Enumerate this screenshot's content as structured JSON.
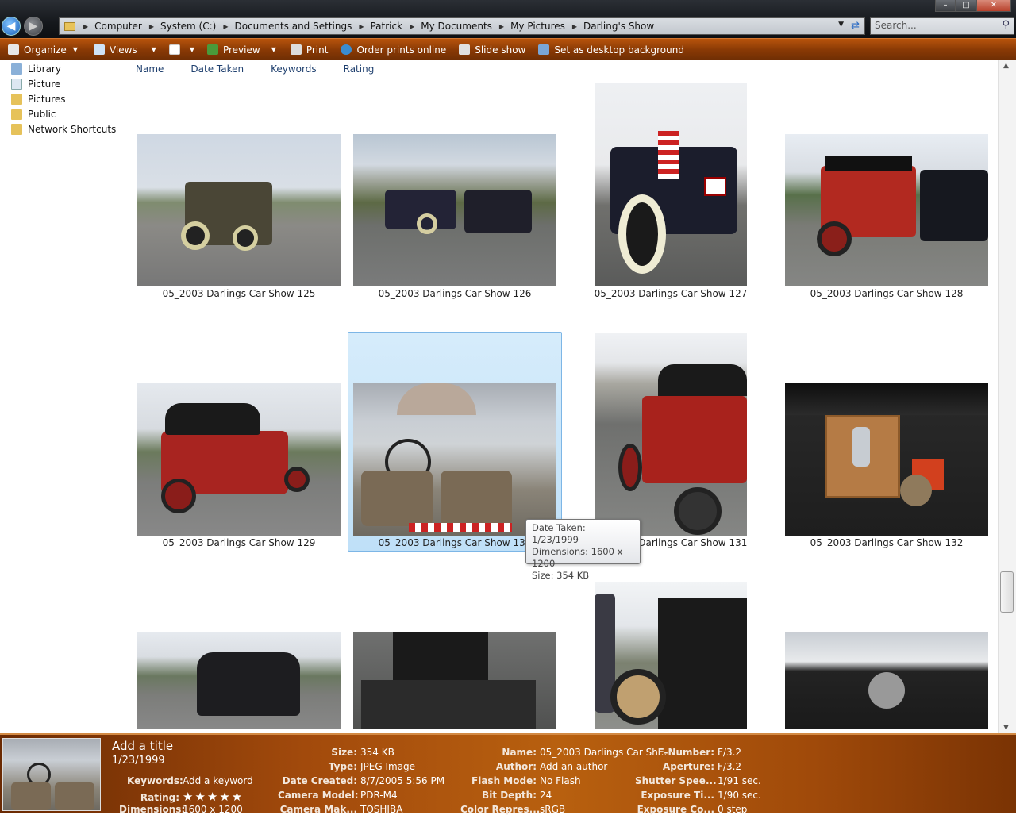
{
  "window": {
    "controls": [
      "–",
      "□",
      "✕"
    ]
  },
  "address": {
    "crumbs": [
      "Computer",
      "System (C:)",
      "Documents and Settings",
      "Patrick",
      "My Documents",
      "My Pictures",
      "Darling's Show"
    ]
  },
  "search": {
    "placeholder": "Search..."
  },
  "toolbar": {
    "organize": "Organize",
    "views": "Views",
    "preview": "Preview",
    "print": "Print",
    "order": "Order prints online",
    "slideshow": "Slide show",
    "desktop": "Set as desktop background"
  },
  "sidebar": {
    "items": [
      {
        "label": "Library",
        "icon": "library-icon"
      },
      {
        "label": "Picture",
        "icon": "picture-icon"
      },
      {
        "label": "Pictures",
        "icon": "folder-icon"
      },
      {
        "label": "Public",
        "icon": "folder-icon"
      },
      {
        "label": "Network Shortcuts",
        "icon": "folder-icon"
      }
    ]
  },
  "columns": [
    "Name",
    "Date Taken",
    "Keywords",
    "Rating"
  ],
  "photos": [
    {
      "caption": "05_2003 Darlings Car Show 125"
    },
    {
      "caption": "05_2003 Darlings Car Show 126"
    },
    {
      "caption": "05_2003 Darlings Car Show 127"
    },
    {
      "caption": "05_2003 Darlings Car Show 128"
    },
    {
      "caption": "05_2003 Darlings Car Show 129"
    },
    {
      "caption": "05_2003 Darlings Car Show 130"
    },
    {
      "caption": "05_2003 Darlings Car Show 131"
    },
    {
      "caption": "05_2003 Darlings Car Show 132"
    }
  ],
  "tooltip": {
    "date": "Date Taken: 1/23/1999",
    "dims": "Dimensions: 1600 x 1200",
    "size": "Size: 354 KB"
  },
  "details": {
    "title": "Add a title",
    "date": "1/23/1999",
    "keywords_k": "Keywords:",
    "keywords_v": "Add a keyword",
    "rating_k": "Rating:",
    "rating_stars": "★★★★★",
    "dimensions_k": "Dimensions:",
    "dimensions_v": "1600 x 1200",
    "size_k": "Size:",
    "size_v": "354 KB",
    "type_k": "Type:",
    "type_v": "JPEG Image",
    "created_k": "Date Created:",
    "created_v": "8/7/2005 5:56 PM",
    "model_k": "Camera Model:",
    "model_v": "PDR-M4",
    "maker_k": "Camera Mak...",
    "maker_v": "TOSHIBA",
    "name_k": "Name:",
    "name_v": "05_2003 Darlings Car Sh...",
    "author_k": "Author:",
    "author_v": "Add an author",
    "flash_k": "Flash Mode:",
    "flash_v": "No Flash",
    "bit_k": "Bit Depth:",
    "bit_v": "24",
    "color_k": "Color Repres...",
    "color_v": "sRGB",
    "fnum_k": "F-Number:",
    "fnum_v": "F/3.2",
    "aperture_k": "Aperture:",
    "aperture_v": "F/3.2",
    "shutter_k": "Shutter Spee...",
    "shutter_v": "1/91 sec.",
    "exposure_k": "Exposure Ti...",
    "exposure_v": "1/90 sec.",
    "expcomp_k": "Exposure Co...",
    "expcomp_v": "0 step"
  }
}
